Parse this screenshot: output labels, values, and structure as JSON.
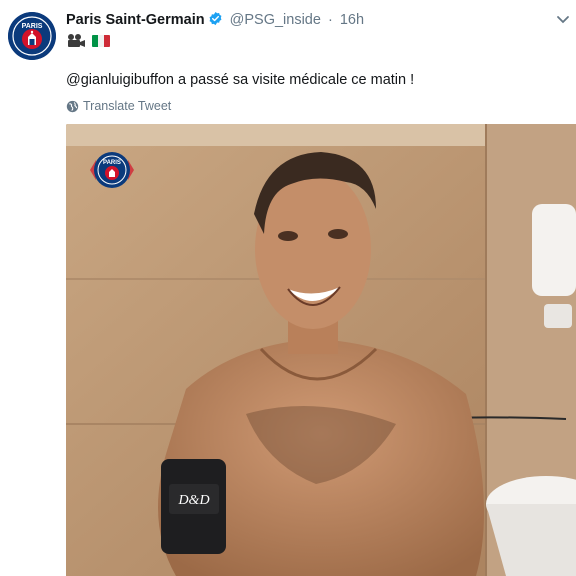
{
  "tweet": {
    "account_name": "Paris Saint-Germain",
    "handle": "@PSG_inside",
    "separator": "·",
    "time": "16h",
    "emoji_row": [
      "video-camera-icon",
      "italy-flag-icon"
    ],
    "mention": "@gianluigibuffon",
    "text_rest": " a passé sa visite médicale ce matin !",
    "translate_label": "Translate Tweet"
  },
  "colors": {
    "psg_blue": "#0b3a7c",
    "psg_red": "#d3122a",
    "verified_blue": "#1da1f2",
    "muted_text": "#657786"
  },
  "media": {
    "type": "video-thumbnail",
    "watermark": "psg-logo",
    "armband_text": "D&D"
  }
}
